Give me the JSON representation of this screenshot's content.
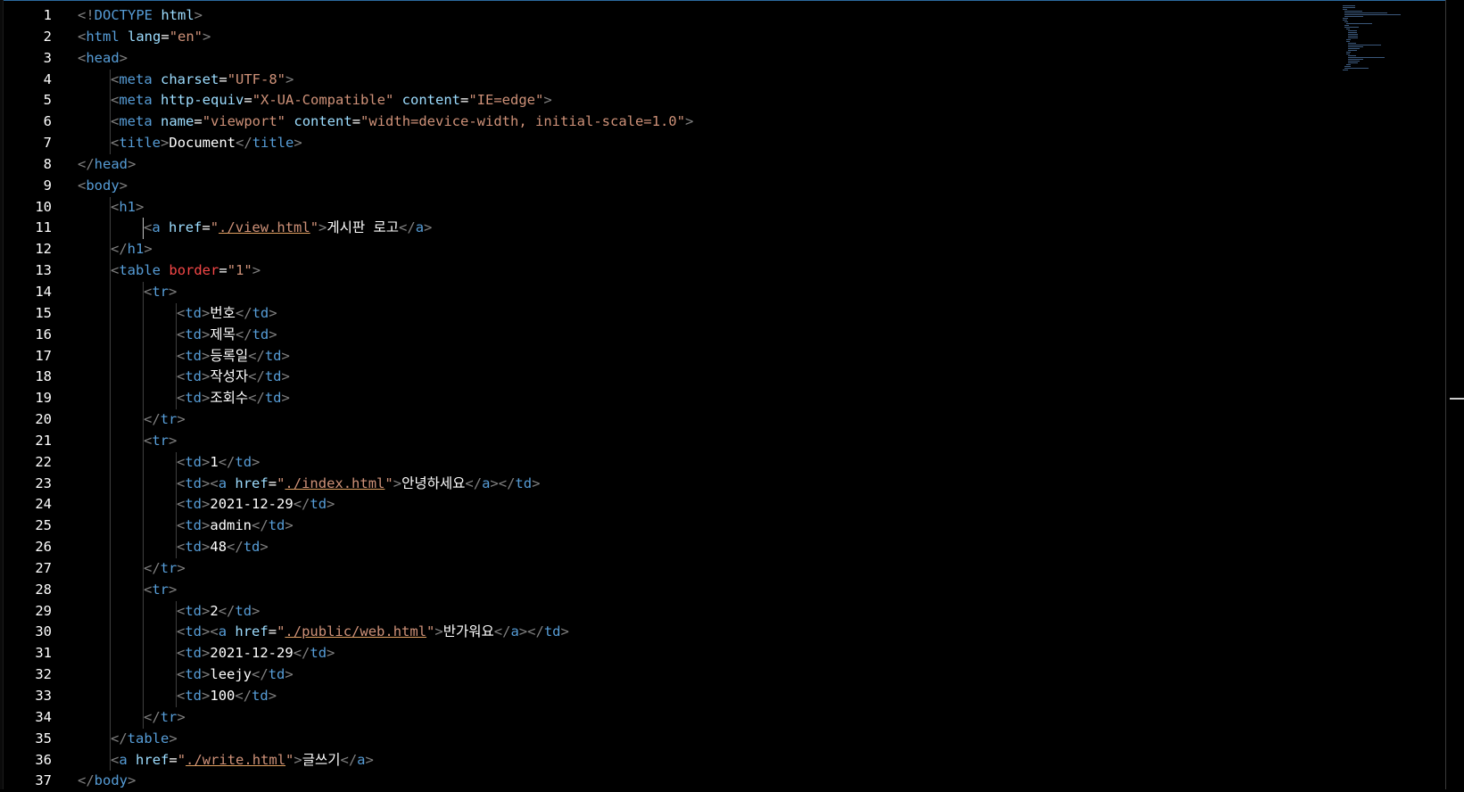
{
  "editor": {
    "language": "html",
    "lines": [
      {
        "n": "1",
        "tokens": [
          [
            "p",
            "<!"
          ],
          [
            "t",
            "DOCTYPE"
          ],
          [
            "p",
            " "
          ],
          [
            "a",
            "html"
          ],
          [
            "p",
            ">"
          ]
        ]
      },
      {
        "n": "2",
        "tokens": [
          [
            "p",
            "<"
          ],
          [
            "t",
            "html"
          ],
          [
            "p",
            " "
          ],
          [
            "a",
            "lang"
          ],
          [
            "x",
            "="
          ],
          [
            "s",
            "\"en\""
          ],
          [
            "p",
            ">"
          ]
        ]
      },
      {
        "n": "3",
        "tokens": [
          [
            "p",
            "<"
          ],
          [
            "t",
            "head"
          ],
          [
            "p",
            ">"
          ]
        ]
      },
      {
        "n": "4",
        "tokens": [
          [
            "p",
            "<"
          ],
          [
            "t",
            "meta"
          ],
          [
            "p",
            " "
          ],
          [
            "a",
            "charset"
          ],
          [
            "x",
            "="
          ],
          [
            "s",
            "\"UTF-8\""
          ],
          [
            "p",
            ">"
          ]
        ]
      },
      {
        "n": "5",
        "tokens": [
          [
            "p",
            "<"
          ],
          [
            "t",
            "meta"
          ],
          [
            "p",
            " "
          ],
          [
            "a",
            "http-equiv"
          ],
          [
            "x",
            "="
          ],
          [
            "s",
            "\"X-UA-Compatible\""
          ],
          [
            "p",
            " "
          ],
          [
            "a",
            "content"
          ],
          [
            "x",
            "="
          ],
          [
            "s",
            "\"IE=edge\""
          ],
          [
            "p",
            ">"
          ]
        ]
      },
      {
        "n": "6",
        "tokens": [
          [
            "p",
            "<"
          ],
          [
            "t",
            "meta"
          ],
          [
            "p",
            " "
          ],
          [
            "a",
            "name"
          ],
          [
            "x",
            "="
          ],
          [
            "s",
            "\"viewport\""
          ],
          [
            "p",
            " "
          ],
          [
            "a",
            "content"
          ],
          [
            "x",
            "="
          ],
          [
            "s",
            "\"width=device-width, initial-scale=1.0\""
          ],
          [
            "p",
            ">"
          ]
        ]
      },
      {
        "n": "7",
        "tokens": [
          [
            "p",
            "<"
          ],
          [
            "t",
            "title"
          ],
          [
            "p",
            ">"
          ],
          [
            "x",
            "Document"
          ],
          [
            "p",
            "</"
          ],
          [
            "t",
            "title"
          ],
          [
            "p",
            ">"
          ]
        ]
      },
      {
        "n": "8",
        "tokens": [
          [
            "p",
            "</"
          ],
          [
            "t",
            "head"
          ],
          [
            "p",
            ">"
          ]
        ]
      },
      {
        "n": "9",
        "tokens": [
          [
            "p",
            "<"
          ],
          [
            "t",
            "body"
          ],
          [
            "p",
            ">"
          ]
        ]
      },
      {
        "n": "10",
        "tokens": [
          [
            "p",
            "<"
          ],
          [
            "t",
            "h1"
          ],
          [
            "p",
            ">"
          ]
        ]
      },
      {
        "n": "11",
        "tokens": [
          [
            "p",
            "<"
          ],
          [
            "t",
            "a"
          ],
          [
            "p",
            " "
          ],
          [
            "a",
            "href"
          ],
          [
            "x",
            "="
          ],
          [
            "s",
            "\""
          ],
          [
            "su",
            "./view.html"
          ],
          [
            "s",
            "\""
          ],
          [
            "p",
            ">"
          ],
          [
            "x",
            "게시판 로고"
          ],
          [
            "p",
            "</"
          ],
          [
            "t",
            "a"
          ],
          [
            "p",
            ">"
          ]
        ]
      },
      {
        "n": "12",
        "tokens": [
          [
            "p",
            "</"
          ],
          [
            "t",
            "h1"
          ],
          [
            "p",
            ">"
          ]
        ]
      },
      {
        "n": "13",
        "tokens": [
          [
            "p",
            "<"
          ],
          [
            "t",
            "table"
          ],
          [
            "p",
            " "
          ],
          [
            "ar",
            "border"
          ],
          [
            "x",
            "="
          ],
          [
            "s",
            "\"1\""
          ],
          [
            "p",
            ">"
          ]
        ]
      },
      {
        "n": "14",
        "tokens": [
          [
            "p",
            "<"
          ],
          [
            "t",
            "tr"
          ],
          [
            "p",
            ">"
          ]
        ]
      },
      {
        "n": "15",
        "tokens": [
          [
            "p",
            "<"
          ],
          [
            "t",
            "td"
          ],
          [
            "p",
            ">"
          ],
          [
            "x",
            "번호"
          ],
          [
            "p",
            "</"
          ],
          [
            "t",
            "td"
          ],
          [
            "p",
            ">"
          ]
        ]
      },
      {
        "n": "16",
        "tokens": [
          [
            "p",
            "<"
          ],
          [
            "t",
            "td"
          ],
          [
            "p",
            ">"
          ],
          [
            "x",
            "제목"
          ],
          [
            "p",
            "</"
          ],
          [
            "t",
            "td"
          ],
          [
            "p",
            ">"
          ]
        ]
      },
      {
        "n": "17",
        "tokens": [
          [
            "p",
            "<"
          ],
          [
            "t",
            "td"
          ],
          [
            "p",
            ">"
          ],
          [
            "x",
            "등록일"
          ],
          [
            "p",
            "</"
          ],
          [
            "t",
            "td"
          ],
          [
            "p",
            ">"
          ]
        ]
      },
      {
        "n": "18",
        "tokens": [
          [
            "p",
            "<"
          ],
          [
            "t",
            "td"
          ],
          [
            "p",
            ">"
          ],
          [
            "x",
            "작성자"
          ],
          [
            "p",
            "</"
          ],
          [
            "t",
            "td"
          ],
          [
            "p",
            ">"
          ]
        ]
      },
      {
        "n": "19",
        "tokens": [
          [
            "p",
            "<"
          ],
          [
            "t",
            "td"
          ],
          [
            "p",
            ">"
          ],
          [
            "x",
            "조회수"
          ],
          [
            "p",
            "</"
          ],
          [
            "t",
            "td"
          ],
          [
            "p",
            ">"
          ]
        ]
      },
      {
        "n": "20",
        "tokens": [
          [
            "p",
            "</"
          ],
          [
            "t",
            "tr"
          ],
          [
            "p",
            ">"
          ]
        ]
      },
      {
        "n": "21",
        "tokens": [
          [
            "p",
            "<"
          ],
          [
            "t",
            "tr"
          ],
          [
            "p",
            ">"
          ]
        ]
      },
      {
        "n": "22",
        "tokens": [
          [
            "p",
            "<"
          ],
          [
            "t",
            "td"
          ],
          [
            "p",
            ">"
          ],
          [
            "x",
            "1"
          ],
          [
            "p",
            "</"
          ],
          [
            "t",
            "td"
          ],
          [
            "p",
            ">"
          ]
        ]
      },
      {
        "n": "23",
        "tokens": [
          [
            "p",
            "<"
          ],
          [
            "t",
            "td"
          ],
          [
            "p",
            ">"
          ],
          [
            "p",
            "<"
          ],
          [
            "t",
            "a"
          ],
          [
            "p",
            " "
          ],
          [
            "a",
            "href"
          ],
          [
            "x",
            "="
          ],
          [
            "s",
            "\""
          ],
          [
            "su",
            "./index.html"
          ],
          [
            "s",
            "\""
          ],
          [
            "p",
            ">"
          ],
          [
            "x",
            "안녕하세요"
          ],
          [
            "p",
            "</"
          ],
          [
            "t",
            "a"
          ],
          [
            "p",
            ">"
          ],
          [
            "p",
            "</"
          ],
          [
            "t",
            "td"
          ],
          [
            "p",
            ">"
          ]
        ]
      },
      {
        "n": "24",
        "tokens": [
          [
            "p",
            "<"
          ],
          [
            "t",
            "td"
          ],
          [
            "p",
            ">"
          ],
          [
            "x",
            "2021-12-29"
          ],
          [
            "p",
            "</"
          ],
          [
            "t",
            "td"
          ],
          [
            "p",
            ">"
          ]
        ]
      },
      {
        "n": "25",
        "tokens": [
          [
            "p",
            "<"
          ],
          [
            "t",
            "td"
          ],
          [
            "p",
            ">"
          ],
          [
            "x",
            "admin"
          ],
          [
            "p",
            "</"
          ],
          [
            "t",
            "td"
          ],
          [
            "p",
            ">"
          ]
        ]
      },
      {
        "n": "26",
        "tokens": [
          [
            "p",
            "<"
          ],
          [
            "t",
            "td"
          ],
          [
            "p",
            ">"
          ],
          [
            "x",
            "48"
          ],
          [
            "p",
            "</"
          ],
          [
            "t",
            "td"
          ],
          [
            "p",
            ">"
          ]
        ]
      },
      {
        "n": "27",
        "tokens": [
          [
            "p",
            "</"
          ],
          [
            "t",
            "tr"
          ],
          [
            "p",
            ">"
          ]
        ]
      },
      {
        "n": "28",
        "tokens": [
          [
            "p",
            "<"
          ],
          [
            "t",
            "tr"
          ],
          [
            "p",
            ">"
          ]
        ]
      },
      {
        "n": "29",
        "tokens": [
          [
            "p",
            "<"
          ],
          [
            "t",
            "td"
          ],
          [
            "p",
            ">"
          ],
          [
            "x",
            "2"
          ],
          [
            "p",
            "</"
          ],
          [
            "t",
            "td"
          ],
          [
            "p",
            ">"
          ]
        ]
      },
      {
        "n": "30",
        "tokens": [
          [
            "p",
            "<"
          ],
          [
            "t",
            "td"
          ],
          [
            "p",
            ">"
          ],
          [
            "p",
            "<"
          ],
          [
            "t",
            "a"
          ],
          [
            "p",
            " "
          ],
          [
            "a",
            "href"
          ],
          [
            "x",
            "="
          ],
          [
            "s",
            "\""
          ],
          [
            "su",
            "./public/web.html"
          ],
          [
            "s",
            "\""
          ],
          [
            "p",
            ">"
          ],
          [
            "x",
            "반가워요"
          ],
          [
            "p",
            "</"
          ],
          [
            "t",
            "a"
          ],
          [
            "p",
            ">"
          ],
          [
            "p",
            "</"
          ],
          [
            "t",
            "td"
          ],
          [
            "p",
            ">"
          ]
        ]
      },
      {
        "n": "31",
        "tokens": [
          [
            "p",
            "<"
          ],
          [
            "t",
            "td"
          ],
          [
            "p",
            ">"
          ],
          [
            "x",
            "2021-12-29"
          ],
          [
            "p",
            "</"
          ],
          [
            "t",
            "td"
          ],
          [
            "p",
            ">"
          ]
        ]
      },
      {
        "n": "32",
        "tokens": [
          [
            "p",
            "<"
          ],
          [
            "t",
            "td"
          ],
          [
            "p",
            ">"
          ],
          [
            "x",
            "leejy"
          ],
          [
            "p",
            "</"
          ],
          [
            "t",
            "td"
          ],
          [
            "p",
            ">"
          ]
        ]
      },
      {
        "n": "33",
        "tokens": [
          [
            "p",
            "<"
          ],
          [
            "t",
            "td"
          ],
          [
            "p",
            ">"
          ],
          [
            "x",
            "100"
          ],
          [
            "p",
            "</"
          ],
          [
            "t",
            "td"
          ],
          [
            "p",
            ">"
          ]
        ]
      },
      {
        "n": "34",
        "tokens": [
          [
            "p",
            "</"
          ],
          [
            "t",
            "tr"
          ],
          [
            "p",
            ">"
          ]
        ]
      },
      {
        "n": "35",
        "tokens": [
          [
            "p",
            "</"
          ],
          [
            "t",
            "table"
          ],
          [
            "p",
            ">"
          ]
        ]
      },
      {
        "n": "36",
        "tokens": [
          [
            "p",
            "<"
          ],
          [
            "t",
            "a"
          ],
          [
            "p",
            " "
          ],
          [
            "a",
            "href"
          ],
          [
            "x",
            "="
          ],
          [
            "s",
            "\""
          ],
          [
            "su",
            "./write.html"
          ],
          [
            "s",
            "\""
          ],
          [
            "p",
            ">"
          ],
          [
            "x",
            "글쓰기"
          ],
          [
            "p",
            "</"
          ],
          [
            "t",
            "a"
          ],
          [
            "p",
            ">"
          ]
        ]
      },
      {
        "n": "37",
        "tokens": [
          [
            "p",
            "</"
          ],
          [
            "t",
            "body"
          ],
          [
            "p",
            ">"
          ]
        ]
      }
    ]
  },
  "colors": {
    "background": "#000000",
    "tag": "#569cd6",
    "attribute": "#9cdcfe",
    "attribute_warning": "#f44747",
    "string": "#ce9178",
    "text": "#ffffff",
    "punctuation": "#808080",
    "line_number": "#ffffff"
  }
}
